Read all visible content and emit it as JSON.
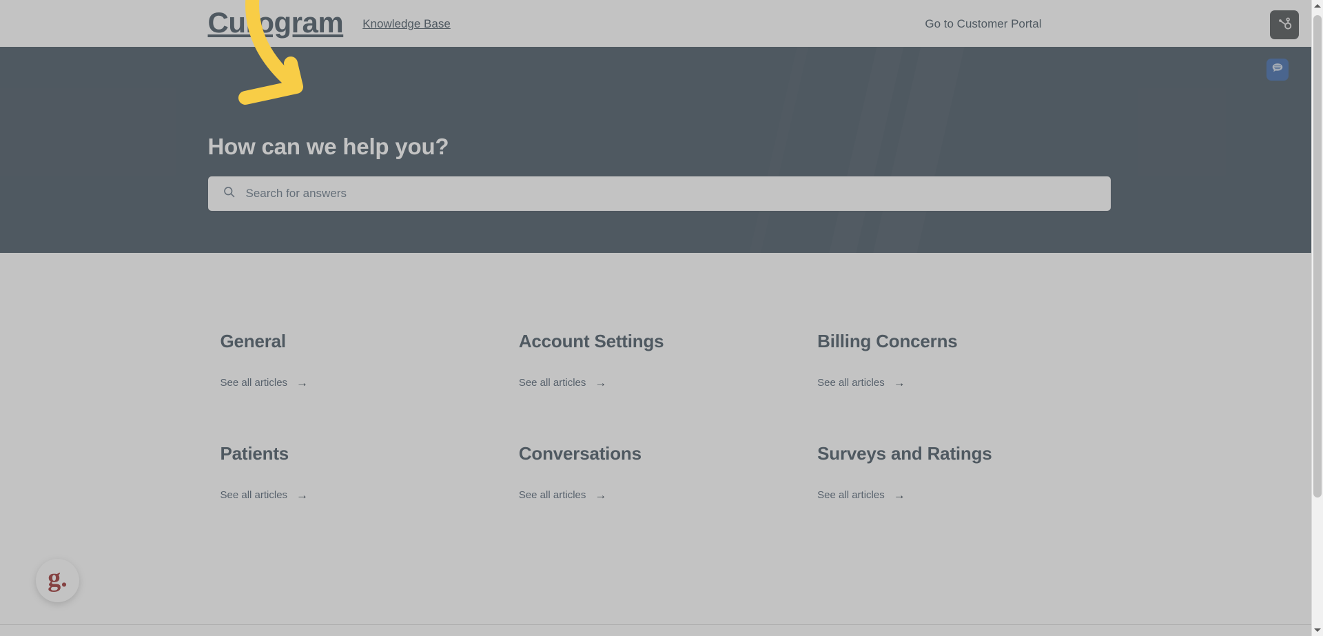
{
  "header": {
    "brand": "Curogram",
    "section_label": "Knowledge Base",
    "portal_link": "Go to Customer Portal",
    "hubspot_icon": "hubspot-sprocket-icon"
  },
  "hero": {
    "title": "How can we help you?",
    "search_placeholder": "Search for answers",
    "search_value": "",
    "search_icon": "search-icon",
    "chat_widget_icon": "chat-bubble-icon",
    "background_color": "#253746"
  },
  "categories": [
    {
      "title": "General",
      "link_label": "See all articles",
      "arrow": "→"
    },
    {
      "title": "Account Settings",
      "link_label": "See all articles",
      "arrow": "→"
    },
    {
      "title": "Billing Concerns",
      "link_label": "See all articles",
      "arrow": "→"
    },
    {
      "title": "Patients",
      "link_label": "See all articles",
      "arrow": "→"
    },
    {
      "title": "Conversations",
      "link_label": "See all articles",
      "arrow": "→"
    },
    {
      "title": "Surveys and Ratings",
      "link_label": "See all articles",
      "arrow": "→"
    }
  ],
  "chat_launcher": {
    "label": "g.",
    "brand_color": "#8a0d0d"
  },
  "annotation": {
    "type": "curved-down-right-arrow",
    "color": "#f8cd46"
  },
  "scrollbar": {
    "up_arrow": "scroll-up-arrow",
    "down_arrow": "scroll-down-arrow"
  }
}
